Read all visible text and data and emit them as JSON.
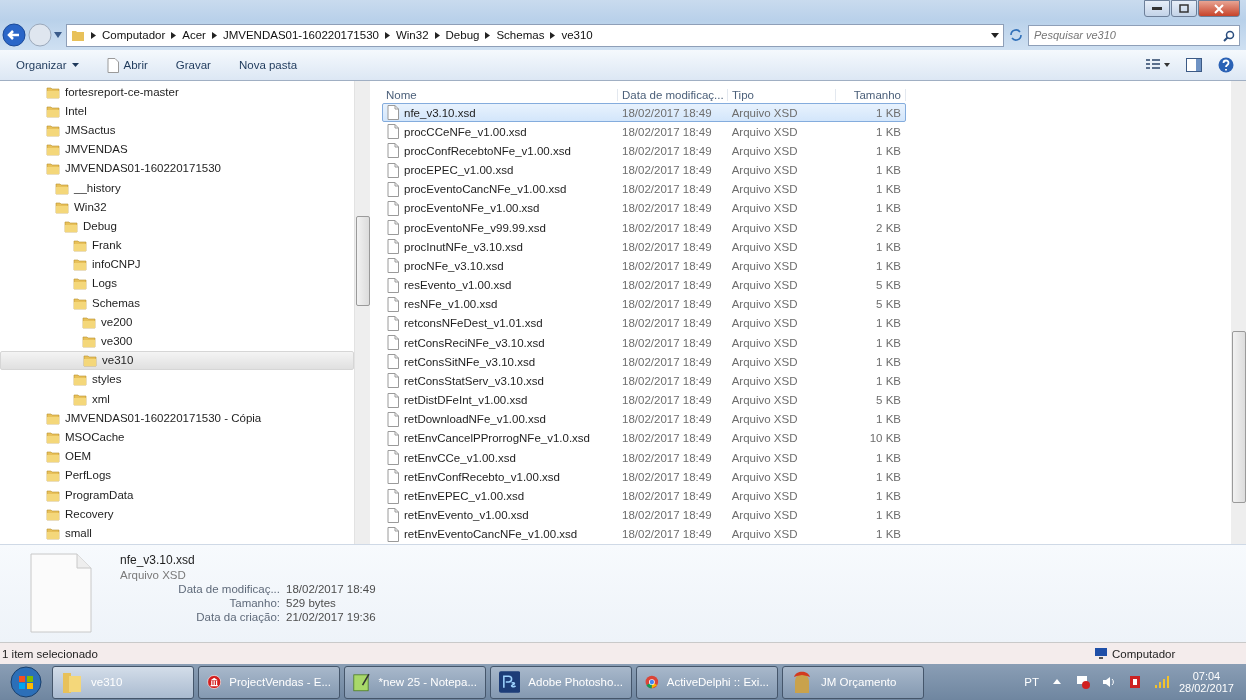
{
  "address_bar": {
    "crumbs": [
      "Computador",
      "Acer",
      "JMVENDAS01-160220171530",
      "Win32",
      "Debug",
      "Schemas",
      "ve310"
    ]
  },
  "search": {
    "placeholder": "Pesquisar ve310"
  },
  "toolbar": {
    "buttons": [
      {
        "label": "Organizar",
        "kind": "menu"
      },
      {
        "label": "Abrir",
        "kind": "file"
      },
      {
        "label": "Gravar",
        "kind": "plain"
      },
      {
        "label": "Nova pasta",
        "kind": "plain"
      }
    ]
  },
  "tree": [
    {
      "label": "fortesreport-ce-master",
      "selected": false
    },
    {
      "label": "Intel",
      "selected": false
    },
    {
      "label": "JMSactus",
      "selected": false
    },
    {
      "label": "JMVENDAS",
      "selected": false
    },
    {
      "label": "JMVENDAS01-160220171530",
      "selected": false,
      "children": [
        {
          "label": "__history",
          "selected": false
        },
        {
          "label": "Win32",
          "selected": false,
          "children": [
            {
              "label": "Debug",
              "selected": false,
              "children": [
                {
                  "label": "Frank",
                  "selected": false
                },
                {
                  "label": "infoCNPJ",
                  "selected": false
                },
                {
                  "label": "Logs",
                  "selected": false
                },
                {
                  "label": "Schemas",
                  "selected": false,
                  "children": [
                    {
                      "label": "ve200",
                      "selected": false
                    },
                    {
                      "label": "ve300",
                      "selected": false
                    },
                    {
                      "label": "ve310",
                      "selected": true
                    }
                  ]
                },
                {
                  "label": "styles",
                  "selected": false
                },
                {
                  "label": "xml",
                  "selected": false
                }
              ]
            }
          ]
        }
      ]
    },
    {
      "label": "JMVENDAS01-160220171530 - Cópia",
      "selected": false
    },
    {
      "label": "MSOCache",
      "selected": false
    },
    {
      "label": "OEM",
      "selected": false
    },
    {
      "label": "PerfLogs",
      "selected": false
    },
    {
      "label": "ProgramData",
      "selected": false
    },
    {
      "label": "Recovery",
      "selected": false
    },
    {
      "label": "small",
      "selected": false
    }
  ],
  "file_list": {
    "columns": [
      "Nome",
      "Data de modificaç...",
      "Tipo",
      "Tamanho"
    ],
    "rows": [
      {
        "name": "nfe_v3.10.xsd",
        "modified": "18/02/2017 18:49",
        "type": "Arquivo XSD",
        "size": "1 KB",
        "selected": true
      },
      {
        "name": "procCCeNFe_v1.00.xsd",
        "modified": "18/02/2017 18:49",
        "type": "Arquivo XSD",
        "size": "1 KB",
        "selected": false
      },
      {
        "name": "procConfRecebtoNFe_v1.00.xsd",
        "modified": "18/02/2017 18:49",
        "type": "Arquivo XSD",
        "size": "1 KB",
        "selected": false
      },
      {
        "name": "procEPEC_v1.00.xsd",
        "modified": "18/02/2017 18:49",
        "type": "Arquivo XSD",
        "size": "1 KB",
        "selected": false
      },
      {
        "name": "procEventoCancNFe_v1.00.xsd",
        "modified": "18/02/2017 18:49",
        "type": "Arquivo XSD",
        "size": "1 KB",
        "selected": false
      },
      {
        "name": "procEventoNFe_v1.00.xsd",
        "modified": "18/02/2017 18:49",
        "type": "Arquivo XSD",
        "size": "1 KB",
        "selected": false
      },
      {
        "name": "procEventoNFe_v99.99.xsd",
        "modified": "18/02/2017 18:49",
        "type": "Arquivo XSD",
        "size": "2 KB",
        "selected": false
      },
      {
        "name": "procInutNFe_v3.10.xsd",
        "modified": "18/02/2017 18:49",
        "type": "Arquivo XSD",
        "size": "1 KB",
        "selected": false
      },
      {
        "name": "procNFe_v3.10.xsd",
        "modified": "18/02/2017 18:49",
        "type": "Arquivo XSD",
        "size": "1 KB",
        "selected": false
      },
      {
        "name": "resEvento_v1.00.xsd",
        "modified": "18/02/2017 18:49",
        "type": "Arquivo XSD",
        "size": "5 KB",
        "selected": false
      },
      {
        "name": "resNFe_v1.00.xsd",
        "modified": "18/02/2017 18:49",
        "type": "Arquivo XSD",
        "size": "5 KB",
        "selected": false
      },
      {
        "name": "retconsNFeDest_v1.01.xsd",
        "modified": "18/02/2017 18:49",
        "type": "Arquivo XSD",
        "size": "1 KB",
        "selected": false
      },
      {
        "name": "retConsReciNFe_v3.10.xsd",
        "modified": "18/02/2017 18:49",
        "type": "Arquivo XSD",
        "size": "1 KB",
        "selected": false
      },
      {
        "name": "retConsSitNFe_v3.10.xsd",
        "modified": "18/02/2017 18:49",
        "type": "Arquivo XSD",
        "size": "1 KB",
        "selected": false
      },
      {
        "name": "retConsStatServ_v3.10.xsd",
        "modified": "18/02/2017 18:49",
        "type": "Arquivo XSD",
        "size": "1 KB",
        "selected": false
      },
      {
        "name": "retDistDFeInt_v1.00.xsd",
        "modified": "18/02/2017 18:49",
        "type": "Arquivo XSD",
        "size": "5 KB",
        "selected": false
      },
      {
        "name": "retDownloadNFe_v1.00.xsd",
        "modified": "18/02/2017 18:49",
        "type": "Arquivo XSD",
        "size": "1 KB",
        "selected": false
      },
      {
        "name": "retEnvCancelPProrrogNFe_v1.0.xsd",
        "modified": "18/02/2017 18:49",
        "type": "Arquivo XSD",
        "size": "10 KB",
        "selected": false
      },
      {
        "name": "retEnvCCe_v1.00.xsd",
        "modified": "18/02/2017 18:49",
        "type": "Arquivo XSD",
        "size": "1 KB",
        "selected": false
      },
      {
        "name": "retEnvConfRecebto_v1.00.xsd",
        "modified": "18/02/2017 18:49",
        "type": "Arquivo XSD",
        "size": "1 KB",
        "selected": false
      },
      {
        "name": "retEnvEPEC_v1.00.xsd",
        "modified": "18/02/2017 18:49",
        "type": "Arquivo XSD",
        "size": "1 KB",
        "selected": false
      },
      {
        "name": "retEnvEvento_v1.00.xsd",
        "modified": "18/02/2017 18:49",
        "type": "Arquivo XSD",
        "size": "1 KB",
        "selected": false
      },
      {
        "name": "retEnvEventoCancNFe_v1.00.xsd",
        "modified": "18/02/2017 18:49",
        "type": "Arquivo XSD",
        "size": "1 KB",
        "selected": false
      }
    ]
  },
  "details": {
    "name": "nfe_v3.10.xsd",
    "type": "Arquivo XSD",
    "properties": [
      {
        "label": "Data de modificaç...",
        "value": "18/02/2017 18:49"
      },
      {
        "label": "Tamanho:",
        "value": "529 bytes"
      },
      {
        "label": "Data da criação:",
        "value": "21/02/2017 19:36"
      }
    ]
  },
  "status_bar": {
    "text": "1 item selecionado",
    "location": "Computador"
  },
  "taskbar": {
    "items": [
      {
        "label": "ve310",
        "kind": "folder",
        "selected": true
      },
      {
        "label": "ProjectVendas - E...",
        "kind": "delphi",
        "selected": false
      },
      {
        "label": "*new 25 - Notepa...",
        "kind": "notepad",
        "selected": false
      },
      {
        "label": "Adobe Photosho...",
        "kind": "photoshop",
        "selected": false
      },
      {
        "label": "ActiveDelphi :: Exi...",
        "kind": "chrome",
        "selected": false
      },
      {
        "label": "JM Orçamento",
        "kind": "helmet",
        "selected": false
      }
    ],
    "language": "PT",
    "time": "07:04",
    "date": "28/02/2017"
  }
}
